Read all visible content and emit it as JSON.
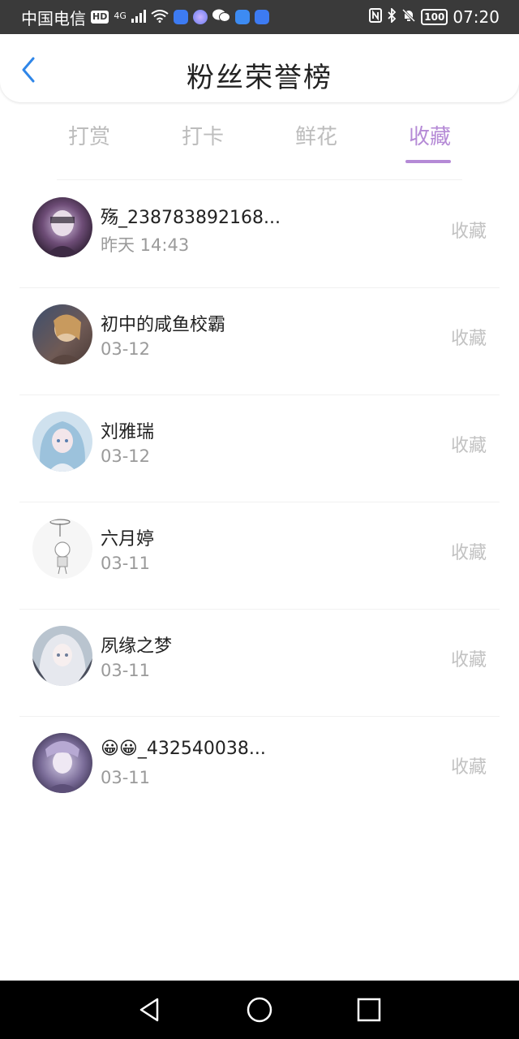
{
  "status_bar": {
    "carrier": "中国电信",
    "hd": "HD",
    "network": "4G",
    "battery": "100",
    "time": "07:20"
  },
  "header": {
    "title": "粉丝荣誉榜",
    "back_icon": "chevron-left-icon"
  },
  "tabs": [
    {
      "label": "打赏",
      "active": false
    },
    {
      "label": "打卡",
      "active": false
    },
    {
      "label": "鲜花",
      "active": false
    },
    {
      "label": "收藏",
      "active": true
    }
  ],
  "accent_color": "#b58ad6",
  "fans": [
    {
      "name": "殇_238783892168...",
      "time": "昨天 14:43",
      "action": "收藏"
    },
    {
      "name": "初中的咸鱼校霸",
      "time": "03-12",
      "action": "收藏"
    },
    {
      "name": "刘雅瑞",
      "time": "03-12",
      "action": "收藏"
    },
    {
      "name": "六月婷",
      "time": "03-11",
      "action": "收藏"
    },
    {
      "name": "夙缘之梦",
      "time": "03-11",
      "action": "收藏"
    },
    {
      "name": "😀😀_432540038...",
      "time": "03-11",
      "action": "收藏"
    }
  ],
  "nav_bar": {
    "back": "triangle-back-icon",
    "home": "circle-home-icon",
    "recents": "square-recents-icon"
  }
}
